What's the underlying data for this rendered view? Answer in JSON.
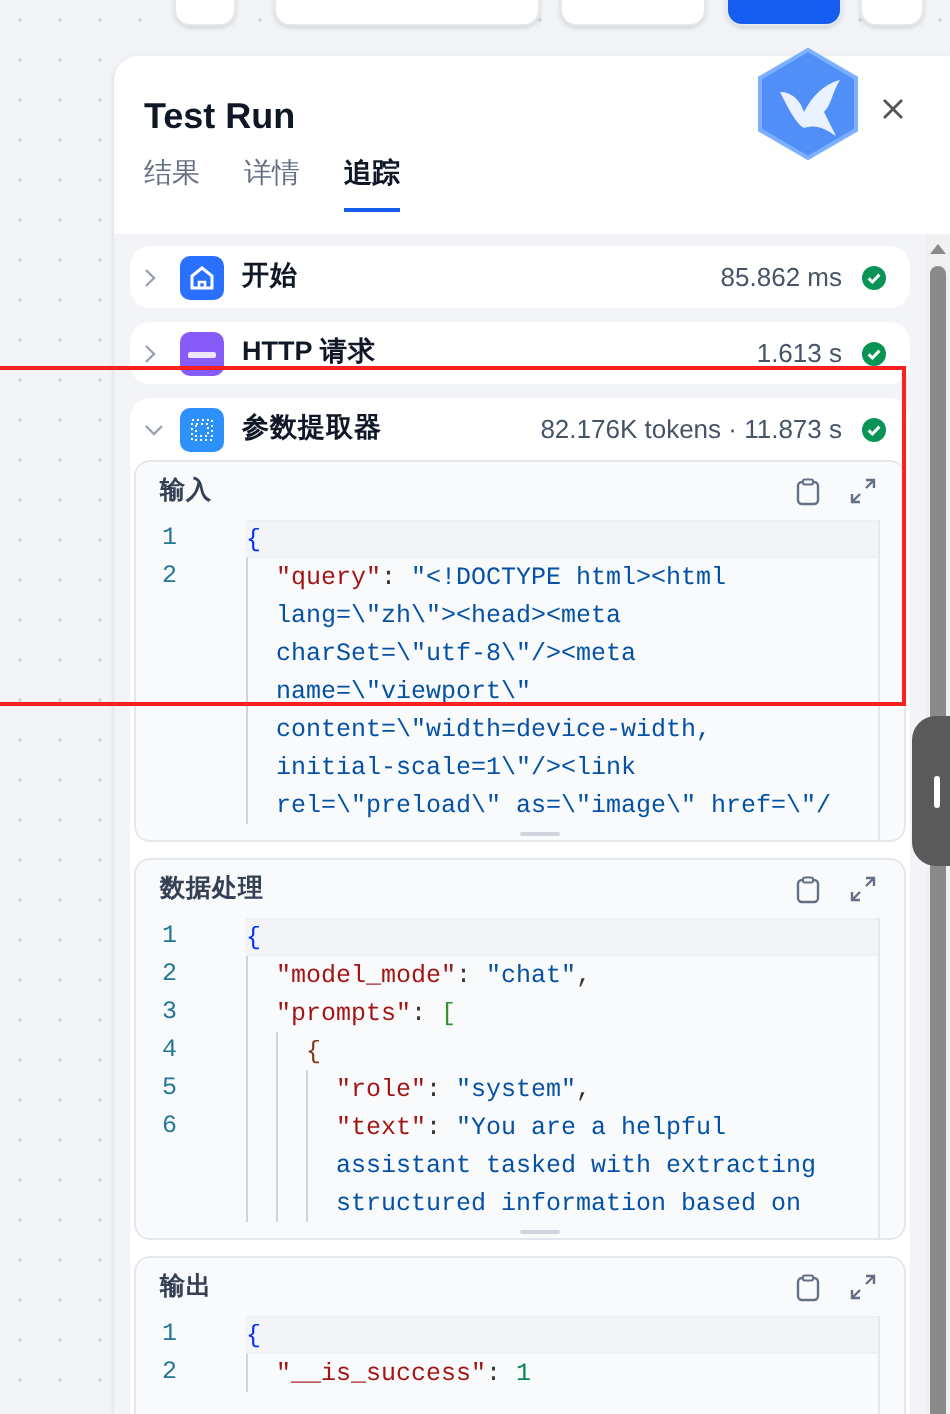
{
  "toolbar": {
    "buttons": [
      {
        "kind": "icon"
      },
      {
        "kind": "run"
      },
      {
        "kind": "feature"
      },
      {
        "kind": "publish"
      },
      {
        "kind": "history"
      }
    ]
  },
  "panel": {
    "title": "Test Run"
  },
  "tabs": [
    {
      "label": "结果",
      "selected": false
    },
    {
      "label": "详情",
      "selected": false
    },
    {
      "label": "追踪",
      "selected": true
    }
  ],
  "nodes": [
    {
      "title": "开始",
      "meta": "85.862 ms",
      "expanded": false
    },
    {
      "title": "HTTP 请求",
      "meta": "1.613 s",
      "expanded": false
    },
    {
      "title": "参数提取器",
      "meta": "82.176K tokens · 11.873 s",
      "expanded": true,
      "sections": [
        {
          "title": "输入",
          "lines": [
            {
              "number": "1",
              "current": true,
              "tokens": [
                {
                  "text": "{",
                  "kind": "brace"
                }
              ]
            },
            {
              "number": "2",
              "current": false,
              "tokens": [
                {
                  "text": "  \"query\"",
                  "kind": "key"
                },
                {
                  "text": ": ",
                  "kind": "punct"
                },
                {
                  "text": "\"<!DOCTYPE html><html",
                  "kind": "string"
                }
              ]
            },
            {
              "current": false,
              "tokens": [
                {
                  "text": "  lang=\\\"zh\\\"><head><meta",
                  "kind": "string"
                }
              ]
            },
            {
              "current": false,
              "tokens": [
                {
                  "text": "  charSet=\\\"utf-8\\\"/><meta",
                  "kind": "string"
                }
              ]
            },
            {
              "current": false,
              "tokens": [
                {
                  "text": "  name=\\\"viewport\\\"",
                  "kind": "string"
                }
              ]
            },
            {
              "current": false,
              "tokens": [
                {
                  "text": "  content=\\\"width=device-width,",
                  "kind": "string"
                }
              ]
            },
            {
              "current": false,
              "tokens": [
                {
                  "text": "  initial-scale=1\\\"/><link",
                  "kind": "string"
                }
              ]
            },
            {
              "current": false,
              "tokens": [
                {
                  "text": "  rel=\\\"preload\\\" as=\\\"image\\\" href=\\\"/",
                  "kind": "string"
                }
              ]
            }
          ]
        },
        {
          "title": "数据处理",
          "lines": [
            {
              "number": "1",
              "current": true,
              "tokens": [
                {
                  "text": "{",
                  "kind": "brace"
                }
              ]
            },
            {
              "number": "2",
              "current": false,
              "tokens": [
                {
                  "text": "  \"model_mode\"",
                  "kind": "key"
                },
                {
                  "text": ": ",
                  "kind": "punct"
                },
                {
                  "text": "\"chat\"",
                  "kind": "string"
                },
                {
                  "text": ",",
                  "kind": "punct"
                }
              ]
            },
            {
              "number": "3",
              "current": false,
              "tokens": [
                {
                  "text": "  \"prompts\"",
                  "kind": "key"
                },
                {
                  "text": ": ",
                  "kind": "punct"
                },
                {
                  "text": "[",
                  "kind": "bracket"
                }
              ]
            },
            {
              "number": "4",
              "current": false,
              "tokens": [
                {
                  "text": "    {",
                  "kind": "brace2"
                }
              ]
            },
            {
              "number": "5",
              "current": false,
              "tokens": [
                {
                  "text": "      \"role\"",
                  "kind": "key"
                },
                {
                  "text": ": ",
                  "kind": "punct"
                },
                {
                  "text": "\"system\"",
                  "kind": "string"
                },
                {
                  "text": ",",
                  "kind": "punct"
                }
              ]
            },
            {
              "number": "6",
              "current": false,
              "tokens": [
                {
                  "text": "      \"text\"",
                  "kind": "key"
                },
                {
                  "text": ": ",
                  "kind": "punct"
                },
                {
                  "text": "\"You are a helpful",
                  "kind": "string"
                }
              ]
            },
            {
              "current": false,
              "tokens": [
                {
                  "text": "      assistant tasked with extracting",
                  "kind": "string"
                }
              ]
            },
            {
              "current": false,
              "tokens": [
                {
                  "text": "      structured information based on",
                  "kind": "string"
                }
              ]
            }
          ]
        },
        {
          "title": "输出",
          "lines": [
            {
              "number": "1",
              "current": true,
              "tokens": [
                {
                  "text": "{",
                  "kind": "brace"
                }
              ]
            },
            {
              "number": "2",
              "current": false,
              "tokens": [
                {
                  "text": "  \"__is_success\"",
                  "kind": "key"
                },
                {
                  "text": ": ",
                  "kind": "punct"
                },
                {
                  "text": "1",
                  "kind": "number"
                }
              ]
            }
          ]
        }
      ]
    }
  ],
  "annotations": [
    {
      "kind": "box"
    }
  ]
}
